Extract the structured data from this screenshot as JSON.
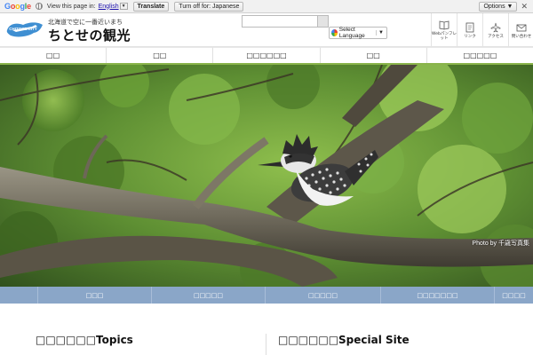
{
  "translate_bar": {
    "logo": "Google",
    "prompt": "View this page in:",
    "language": "English",
    "translate_button": "Translate",
    "turn_off_button": "Turn off for: Japanese",
    "options_button": "Options ▼",
    "close": "✕"
  },
  "header": {
    "logo_text": "CHITOSE CITY",
    "tagline": "北海道で空に一番近いまち",
    "site_title": "ちとせの観光",
    "search_placeholder": "",
    "language_select": "Select Language",
    "utility_links": [
      {
        "icon": "book-icon",
        "label": "Webパンフレット"
      },
      {
        "icon": "link-icon",
        "label": "リンク"
      },
      {
        "icon": "airplane-icon",
        "label": "アクセス"
      },
      {
        "icon": "mail-icon",
        "label": "問い合わせ"
      }
    ]
  },
  "main_nav": [
    "□□",
    "□□",
    "□□□□□□",
    "□□",
    "□□□□□"
  ],
  "hero": {
    "credit": "Photo by 千歳写真集"
  },
  "sub_nav": [
    "□□□",
    "□□□□□",
    "□□□□□",
    "□□□□□□□",
    "□□□□"
  ],
  "sections": {
    "topics": "□□□□□□Topics",
    "special": "□□□□□□Special Site"
  },
  "colors": {
    "nav_accent": "#8ab44b",
    "sub_nav_bg": "#8aa6c8",
    "logo_blue": "#3f8fd2"
  }
}
